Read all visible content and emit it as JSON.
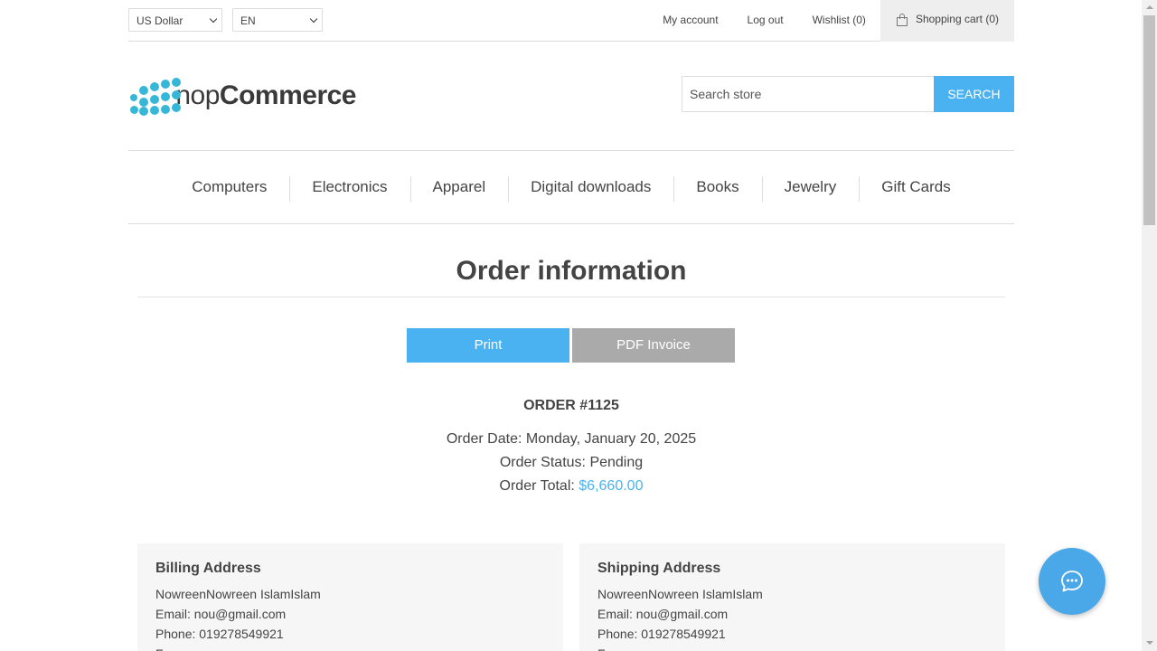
{
  "header": {
    "currency": "US Dollar",
    "language": "EN",
    "links": {
      "my_account": "My account",
      "log_out": "Log out",
      "wishlist": "Wishlist (0)",
      "shopping_cart": "Shopping cart (0)"
    }
  },
  "logo": {
    "prefix": "nop",
    "suffix": "Commerce"
  },
  "search": {
    "placeholder": "Search store",
    "button": "Search"
  },
  "menu": [
    "Computers",
    "Electronics",
    "Apparel",
    "Digital downloads",
    "Books",
    "Jewelry",
    "Gift Cards"
  ],
  "page": {
    "title": "Order information",
    "print_button": "Print",
    "pdf_button": "PDF Invoice"
  },
  "order": {
    "number": "Order #1125",
    "date_label": "Order Date:",
    "date_value": "Monday, January 20, 2025",
    "status_label": "Order Status:",
    "status_value": "Pending",
    "total_label": "Order Total:",
    "total_value": "$6,660.00"
  },
  "billing": {
    "title": "Billing Address",
    "name": "NowreenNowreen IslamIslam",
    "email": "Email: nou@gmail.com",
    "phone": "Phone: 019278549921",
    "fax": "Fax:"
  },
  "shipping": {
    "title": "Shipping Address",
    "name": "NowreenNowreen IslamIslam",
    "email": "Email: nou@gmail.com",
    "phone": "Phone: 019278549921",
    "fax": "Fax:"
  },
  "colors": {
    "accent": "#4ab2f1",
    "logo_blue": "#37b7d8",
    "secondary_button": "#aaaaaa"
  },
  "icons": [
    "chevron-down-icon",
    "shopping-bag-icon",
    "chat-bubble-icon",
    "logo-dots-icon"
  ]
}
